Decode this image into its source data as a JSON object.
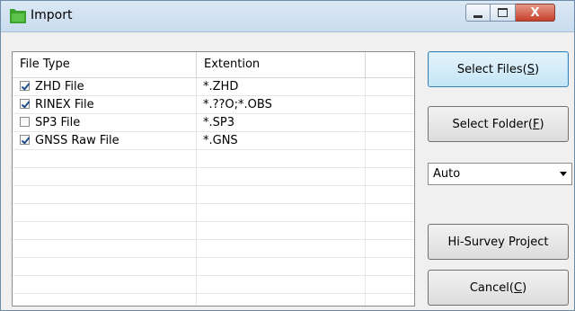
{
  "window": {
    "title": "Import",
    "close_glyph": "X"
  },
  "list": {
    "columns": [
      "File Type",
      "Extention",
      ""
    ],
    "rows": [
      {
        "type": "ZHD File",
        "ext": "*.ZHD",
        "checked": true
      },
      {
        "type": "RINEX File",
        "ext": "*.??O;*.OBS",
        "checked": true
      },
      {
        "type": "SP3 File",
        "ext": "*.SP3",
        "checked": false
      },
      {
        "type": "GNSS Raw File",
        "ext": "*.GNS",
        "checked": true
      }
    ]
  },
  "buttons": {
    "select_files": {
      "label": "Select Files(",
      "key": "S",
      "tail": ")"
    },
    "select_folder": {
      "label": "Select Folder(",
      "key": "F",
      "tail": ")"
    },
    "hi_survey": {
      "label": "Hi-Survey Project"
    },
    "cancel": {
      "label": "Cancel(",
      "key": "C",
      "tail": ")"
    }
  },
  "combo": {
    "value": "Auto"
  },
  "colors": {
    "accent": "#3c7fb1",
    "icon_green": "#3aa32d"
  }
}
